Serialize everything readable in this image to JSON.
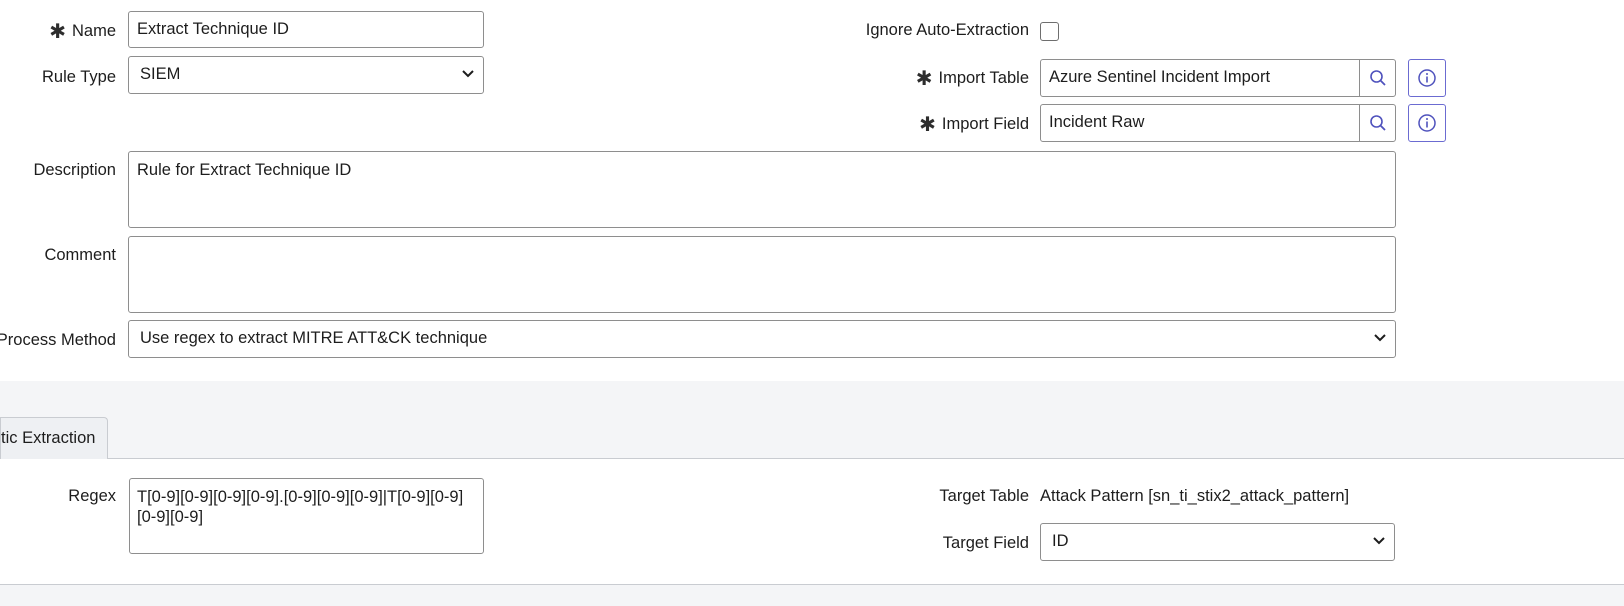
{
  "form": {
    "name_label": "Name",
    "name_value": "Extract Technique ID",
    "rule_type_label": "Rule Type",
    "rule_type_value": "SIEM",
    "ignore_auto_extraction_label": "Ignore Auto-Extraction",
    "ignore_auto_extraction_checked": false,
    "import_table_label": "Import Table",
    "import_table_value": "Azure Sentinel Incident Import",
    "import_field_label": "Import Field",
    "import_field_value": "Incident Raw",
    "description_label": "Description",
    "description_value": "Rule for Extract Technique ID",
    "comment_label": "Comment",
    "comment_value": "",
    "process_method_label": "Process Method",
    "process_method_value": "Use regex to extract MITRE ATT&CK technique"
  },
  "tabs": [
    {
      "label": "tic Extraction"
    }
  ],
  "extraction": {
    "regex_label": "Regex",
    "regex_value": "T[0-9][0-9][0-9][0-9].[0-9][0-9][0-9]|T[0-9][0-9][0-9][0-9]",
    "target_table_label": "Target Table",
    "target_table_value": "Attack Pattern [sn_ti_stix2_attack_pattern]",
    "target_field_label": "Target Field",
    "target_field_value": "ID"
  },
  "icons": {
    "required": "asterisk-icon",
    "lookup": "search-icon",
    "info": "info-icon",
    "dropdown": "chevron-down-icon"
  },
  "colors": {
    "accent": "#4f52bd",
    "border": "#8e8e8e",
    "section_background": "#f4f5f7"
  }
}
